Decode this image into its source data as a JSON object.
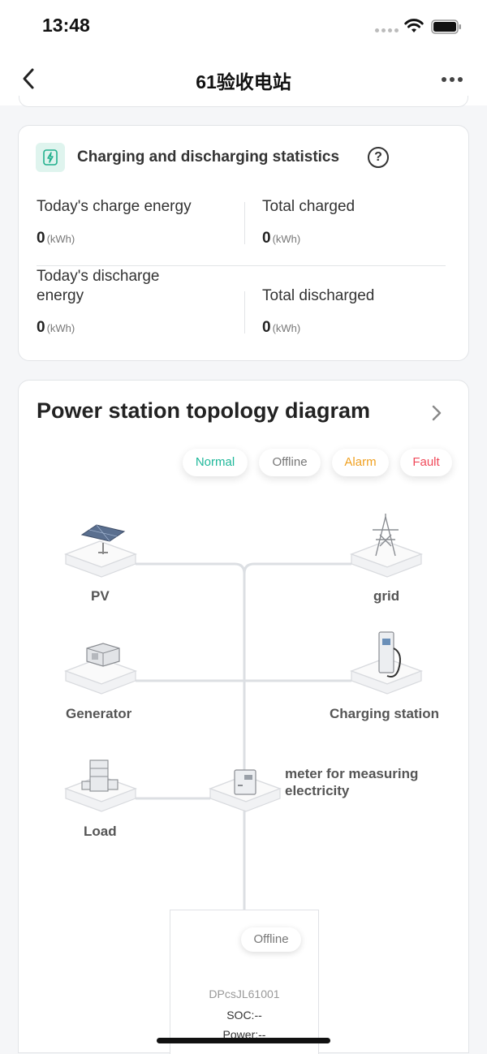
{
  "status_bar": {
    "time": "13:48"
  },
  "nav": {
    "title": "61验收电站"
  },
  "stats": {
    "title": "Charging and discharging statistics",
    "today_charge_label": "Today's charge energy",
    "today_charge_value": "0",
    "total_charged_label": "Total charged",
    "total_charged_value": "0",
    "today_discharge_label_line1": "Today's discharge",
    "today_discharge_label_line2": "energy",
    "today_discharge_value": "0",
    "total_discharged_label": "Total discharged",
    "total_discharged_value": "0",
    "unit": "(kWh)"
  },
  "topology": {
    "title": "Power station topology diagram",
    "legend": [
      {
        "label": "Normal",
        "color": "#1fb89a"
      },
      {
        "label": "Offline",
        "color": "#777777"
      },
      {
        "label": "Alarm",
        "color": "#f0a020"
      },
      {
        "label": "Fault",
        "color": "#f04a5a"
      }
    ],
    "nodes": {
      "pv": "PV",
      "grid": "grid",
      "generator": "Generator",
      "charging_station": "Charging station",
      "load": "Load",
      "meter_line1": "meter for measuring",
      "meter_line2": "electricity"
    },
    "device": {
      "status": "Offline",
      "name": "DPcsJL61001",
      "soc": "SOC:--",
      "power": "Power:--"
    }
  },
  "icons": [
    "back-icon",
    "more-icon",
    "charging-icon",
    "help-icon",
    "chevron-right-icon",
    "wifi-icon",
    "battery-icon"
  ]
}
